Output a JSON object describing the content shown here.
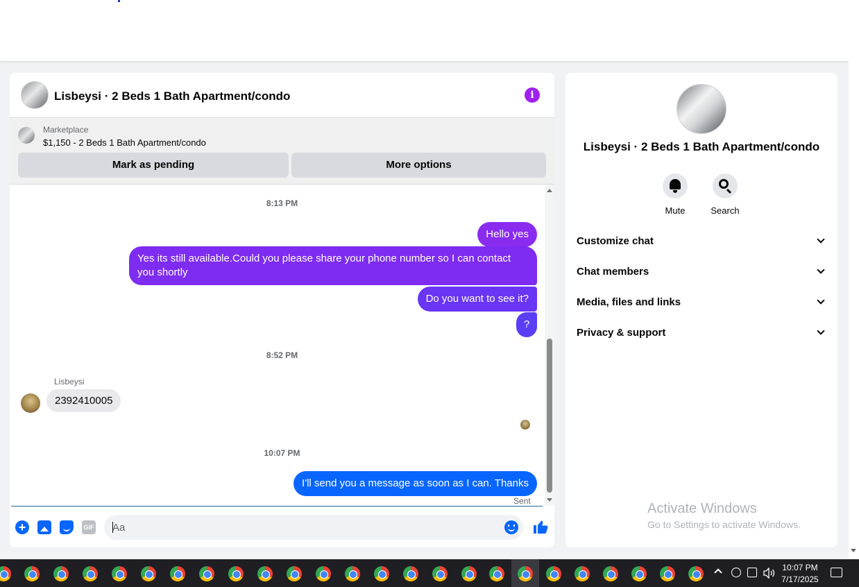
{
  "chat": {
    "title": "Lisbeysi · 2 Beds 1 Bath Apartment/condo",
    "marketplace_label": "Marketplace",
    "listing": "$1,150 - 2 Beds 1 Bath Apartment/condo",
    "mark_pending_label": "Mark as pending",
    "more_options_label": "More options",
    "timestamps": [
      "8:13 PM",
      "8:52 PM",
      "10:07 PM"
    ],
    "messages": [
      {
        "text": "Hello yes",
        "color": "#8a2bf0"
      },
      {
        "text": "Yes its still available.Could you please share your phone number so I can contact you shortly",
        "color": "#7e2cf2"
      },
      {
        "text": "Do you want to see it?",
        "color": "#6a35f5"
      },
      {
        "text": "?",
        "color": "#5a3ef6"
      },
      {
        "text": "I'll send you a message as soon as I can. Thanks",
        "color": "#0866ff"
      }
    ],
    "received": {
      "sender": "Lisbeysi",
      "text": "2392410005"
    },
    "sent_status": "Sent",
    "composer_placeholder": "Aa",
    "gif_label": "GIF"
  },
  "panel": {
    "title": "Lisbeysi · 2 Beds 1 Bath Apartment/condo",
    "mute_label": "Mute",
    "search_label": "Search",
    "sections": [
      "Customize chat",
      "Chat members",
      "Media, files and links",
      "Privacy & support"
    ],
    "watermark_title": "Activate Windows",
    "watermark_sub": "Go to Settings to activate Windows."
  },
  "taskbar": {
    "time": "10:07 PM",
    "date": "7/17/2025"
  },
  "colors": {
    "accent": "#0866ff",
    "info": "#a020f0"
  }
}
